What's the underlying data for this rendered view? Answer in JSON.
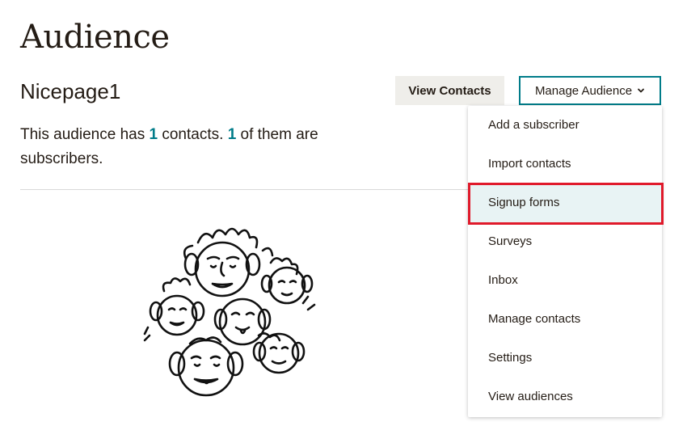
{
  "header": {
    "title": "Audience"
  },
  "audience": {
    "name": "Nicepage1",
    "summary_prefix": "This audience has",
    "contacts_count": "1",
    "summary_mid": "contacts.",
    "subscribers_count": "1",
    "summary_suffix": "of them are subscribers."
  },
  "actions": {
    "view_contacts_label": "View Contacts",
    "manage_audience_label": "Manage Audience"
  },
  "menu": {
    "items": [
      {
        "label": "Add a subscriber"
      },
      {
        "label": "Import contacts"
      },
      {
        "label": "Signup forms",
        "highlighted": true
      },
      {
        "label": "Surveys"
      },
      {
        "label": "Inbox"
      },
      {
        "label": "Manage contacts"
      },
      {
        "label": "Settings"
      },
      {
        "label": "View audiences"
      }
    ]
  },
  "colors": {
    "accent": "#007c89",
    "highlight_border": "#e01a2b",
    "text": "#241c15",
    "secondary_button_bg": "#efeeea"
  },
  "icons": {
    "dropdown": "chevron-down-icon",
    "illustration": "faces-crowd-illustration"
  }
}
